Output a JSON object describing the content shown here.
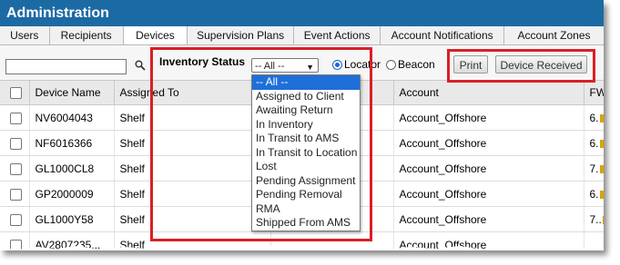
{
  "title": "Administration",
  "tabs": [
    {
      "label": "Users"
    },
    {
      "label": "Recipients"
    },
    {
      "label": "Devices",
      "active": true
    },
    {
      "label": "Supervision Plans"
    },
    {
      "label": "Event Actions"
    },
    {
      "label": "Account Notifications"
    },
    {
      "label": "Account Zones"
    }
  ],
  "toolbar": {
    "search_value": "",
    "inventory_status_label": "Inventory Status",
    "status_selected": "-- All --",
    "radio_locator": "Locator",
    "radio_beacon": "Beacon",
    "radio_selected": "Locator",
    "print_label": "Print",
    "device_received_label": "Device Received"
  },
  "dropdown_options": [
    "-- All --",
    "Assigned to Client",
    "Awaiting Return",
    "In Inventory",
    "In Transit to AMS",
    "In Transit to Location",
    "Lost",
    "Pending Assignment",
    "Pending Removal",
    "RMA",
    "Shipped From AMS"
  ],
  "table": {
    "columns": [
      "Device Name",
      "Assigned To",
      "",
      "Account",
      "FW"
    ],
    "rows": [
      {
        "device": "NV6004043",
        "assigned": "Shelf",
        "account": "Account_Offshore",
        "fw": "6."
      },
      {
        "device": "NF6016366",
        "assigned": "Shelf",
        "account": "Account_Offshore",
        "fw": "6."
      },
      {
        "device": "GL1000CL8",
        "assigned": "Shelf",
        "account": "Account_Offshore",
        "fw": "7."
      },
      {
        "device": "GP2000009",
        "assigned": "Shelf",
        "account": "Account_Offshore",
        "fw": "6."
      },
      {
        "device": "GL1000Y58",
        "assigned": "Shelf",
        "account": "Account_Offshore",
        "fw": "7.."
      },
      {
        "device": "AV2807235...",
        "assigned": "Shelf",
        "account": "Account_Offshore",
        "fw": ""
      }
    ]
  },
  "colors": {
    "title_bar": "#1c6aa3",
    "highlight": "#d91f26",
    "selected_option": "#1e6fd9"
  }
}
